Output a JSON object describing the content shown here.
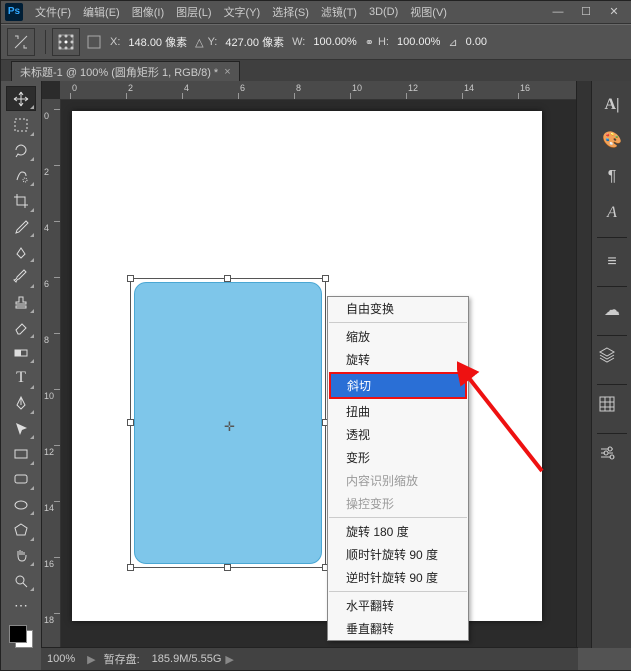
{
  "title": "Ps",
  "menu": [
    "文件(F)",
    "编辑(E)",
    "图像(I)",
    "图层(L)",
    "文字(Y)",
    "选择(S)",
    "滤镜(T)",
    "3D(D)",
    "视图(V)"
  ],
  "winbtns": {
    "min": "—",
    "max": "☐",
    "close": "✕"
  },
  "optbar": {
    "x_label": "X:",
    "x_val": "148.00 像素",
    "y_label": "Y:",
    "y_val": "427.00 像素",
    "w_label": "W:",
    "w_val": "100.00%",
    "h_label": "H:",
    "h_val": "100.00%",
    "angle_icon": "⊿",
    "angle_val": "0.00"
  },
  "doctab": {
    "title": "未标题-1 @ 100% (圆角矩形 1, RGB/8) *",
    "close": "×"
  },
  "ruler": {
    "ticks": [
      "0",
      "2",
      "4",
      "6",
      "8",
      "10",
      "12",
      "14",
      "16"
    ],
    "vticks": [
      "0",
      "2",
      "4",
      "6",
      "8",
      "10",
      "12",
      "14",
      "16",
      "18"
    ]
  },
  "ctx": {
    "freeform": "自由变换",
    "scale": "缩放",
    "rotate": "旋转",
    "skew": "斜切",
    "distort": "扭曲",
    "perspective": "透视",
    "warp": "变形",
    "content_aware": "内容识别缩放",
    "puppet": "操控变形",
    "r180": "旋转 180 度",
    "rcw": "顺时针旋转 90 度",
    "rccw": "逆时针旋转 90 度",
    "fliph": "水平翻转",
    "flipv": "垂直翻转"
  },
  "status": {
    "zoom": "100%",
    "scratch_label": "暂存盘:",
    "scratch_val": "185.9M/5.55G"
  }
}
